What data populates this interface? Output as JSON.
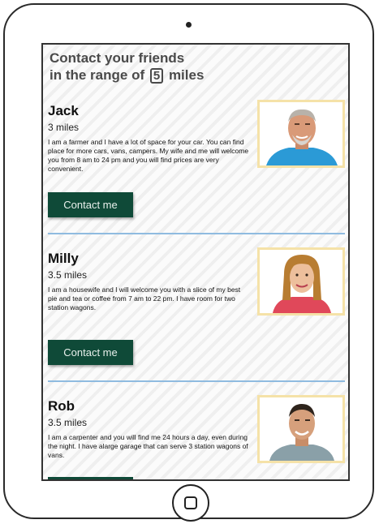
{
  "heading": {
    "line1": "Contact your friends",
    "prefix": "in the range of",
    "range_value": "5",
    "suffix": "miles"
  },
  "contacts": [
    {
      "name": "Jack",
      "distance": "3 miles",
      "description": "I am a farmer and I have a lot of space for your car. You can find place for more cars, vans, campers. My wife and me will welcome you from 8 am to 24 pm and you will find prices are very convenient.",
      "button_label": "Contact me"
    },
    {
      "name": "Milly",
      "distance": "3.5 miles",
      "description": "I am a housewife and I will welcome you with a slice of my best pie and tea or coffee from 7 am to 22 pm. I have room for two station wagons.",
      "button_label": "Contact me"
    },
    {
      "name": "Rob",
      "distance": "3.5 miles",
      "description": "I am a carpenter and you will find me 24 hours a day, even during the night. I have alarge garage that can serve 3 station wagons of vans."
    }
  ]
}
